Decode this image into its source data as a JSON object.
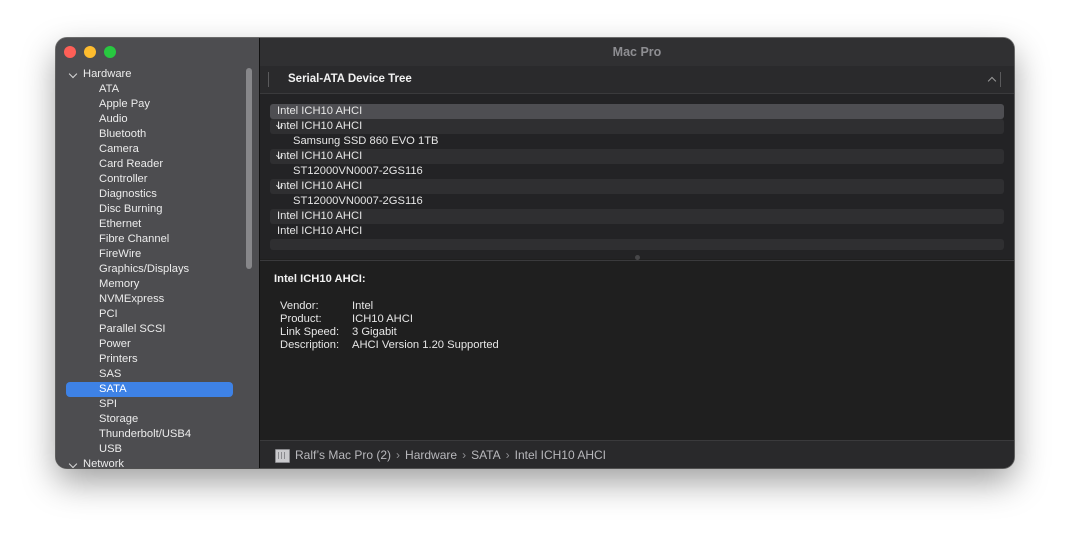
{
  "window": {
    "title": "Mac Pro"
  },
  "sidebar": {
    "groups": [
      {
        "label": "Hardware",
        "items": [
          "ATA",
          "Apple Pay",
          "Audio",
          "Bluetooth",
          "Camera",
          "Card Reader",
          "Controller",
          "Diagnostics",
          "Disc Burning",
          "Ethernet",
          "Fibre Channel",
          "FireWire",
          "Graphics/Displays",
          "Memory",
          "NVMExpress",
          "PCI",
          "Parallel SCSI",
          "Power",
          "Printers",
          "SAS",
          "SATA",
          "SPI",
          "Storage",
          "Thunderbolt/USB4",
          "USB"
        ]
      },
      {
        "label": "Network",
        "items": []
      }
    ],
    "selected": "SATA"
  },
  "content": {
    "header_title": "Serial-ATA Device Tree",
    "devices": [
      {
        "label": "Intel ICH10 AHCI",
        "level": 0,
        "expanded": false,
        "selected": true
      },
      {
        "label": "Intel ICH10 AHCI",
        "level": 0,
        "expanded": true,
        "selected": false
      },
      {
        "label": "Samsung SSD 860 EVO 1TB",
        "level": 1,
        "selected": false
      },
      {
        "label": "Intel ICH10 AHCI",
        "level": 0,
        "expanded": true,
        "selected": false
      },
      {
        "label": "ST12000VN0007-2GS116",
        "level": 1,
        "selected": false
      },
      {
        "label": "Intel ICH10 AHCI",
        "level": 0,
        "expanded": true,
        "selected": false
      },
      {
        "label": "ST12000VN0007-2GS116",
        "level": 1,
        "selected": false
      },
      {
        "label": "Intel ICH10 AHCI",
        "level": 0,
        "expanded": false,
        "selected": false
      },
      {
        "label": "Intel ICH10 AHCI",
        "level": 0,
        "expanded": false,
        "selected": false
      }
    ],
    "detail": {
      "title": "Intel ICH10 AHCI:",
      "properties": [
        {
          "key": "Vendor:",
          "value": "Intel"
        },
        {
          "key": "Product:",
          "value": "ICH10 AHCI"
        },
        {
          "key": "Link Speed:",
          "value": "3 Gigabit"
        },
        {
          "key": "Description:",
          "value": "AHCI Version 1.20 Supported"
        }
      ]
    }
  },
  "statusbar": {
    "icon": "mac-pro-icon",
    "breadcrumbs": [
      "Ralf’s Mac Pro (2)",
      "Hardware",
      "SATA",
      "Intel ICH10 AHCI"
    ],
    "separator": "›"
  },
  "colors": {
    "selection_blue": "#3e82e6",
    "traffic_close": "#fe5f57",
    "traffic_minimize": "#febc2e",
    "traffic_zoom": "#28c840"
  }
}
